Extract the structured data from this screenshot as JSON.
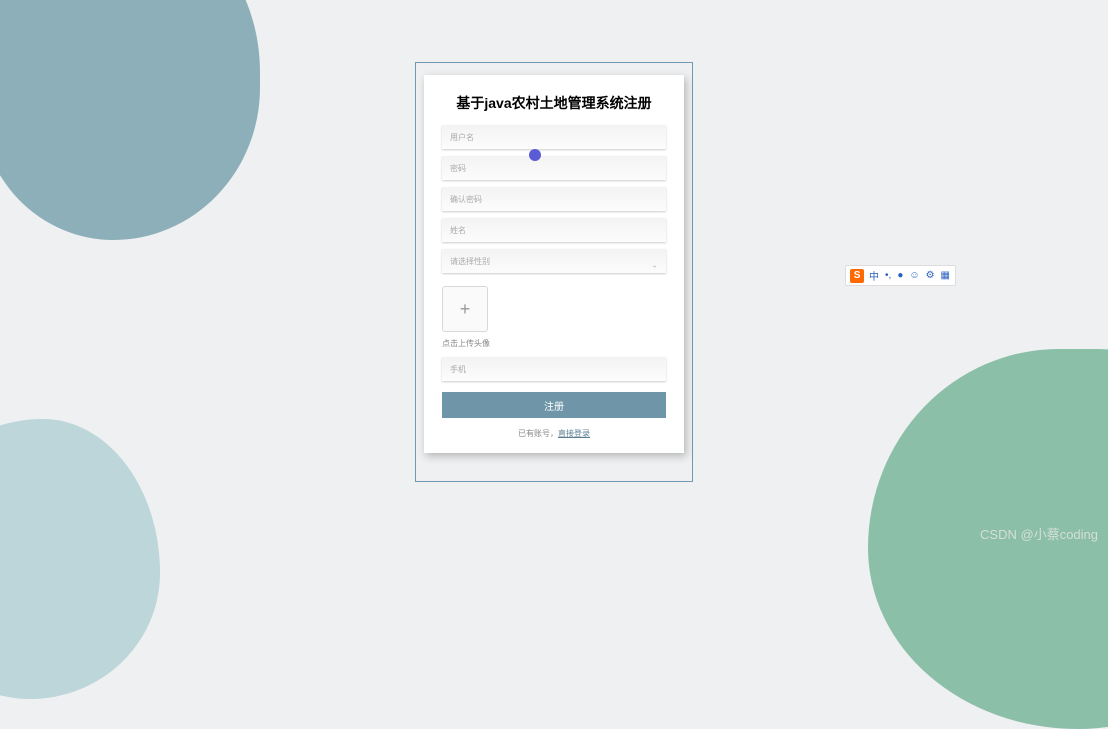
{
  "form": {
    "title": "基于java农村土地管理系统注册",
    "fields": {
      "username_placeholder": "用户名",
      "password_placeholder": "密码",
      "confirm_password_placeholder": "确认密码",
      "name_placeholder": "姓名",
      "gender_placeholder": "请选择性别",
      "phone_placeholder": "手机"
    },
    "upload_label": "点击上传头像",
    "submit_label": "注册",
    "bottom": {
      "has_account": "已有账号，",
      "login_link": "直接登录"
    }
  },
  "ime": {
    "logo": "S",
    "items": [
      "中",
      "•,",
      "●",
      "☺",
      "⚙",
      "▦"
    ]
  },
  "watermark": "CSDN @小蔡coding"
}
